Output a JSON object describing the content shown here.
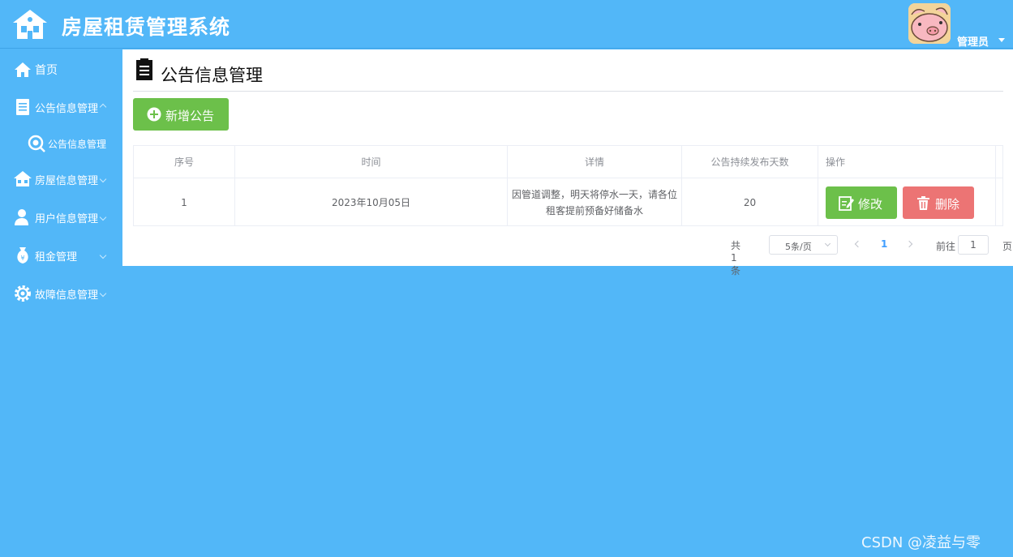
{
  "header": {
    "app_title": "房屋租赁管理系统",
    "user_name": "管理员"
  },
  "sidebar": {
    "items": [
      {
        "label": "首页",
        "icon": "home-icon"
      },
      {
        "label": "公告信息管理",
        "icon": "document-icon"
      },
      {
        "label": "公告信息管理",
        "icon": "search-icon",
        "sub": true
      },
      {
        "label": "房屋信息管理",
        "icon": "house-icon"
      },
      {
        "label": "用户信息管理",
        "icon": "user-icon"
      },
      {
        "label": "租金管理",
        "icon": "money-bag-icon"
      },
      {
        "label": "故障信息管理",
        "icon": "gear-icon"
      }
    ]
  },
  "main": {
    "page_title": "公告信息管理",
    "add_button": "新增公告",
    "table": {
      "columns": [
        "序号",
        "时间",
        "详情",
        "公告持续发布天数",
        "操作"
      ],
      "rows": [
        {
          "index": "1",
          "time": "2023年10月05日",
          "detail": "因管道调整，明天将停水一天，请各位租客提前预备好储备水",
          "days": "20"
        }
      ],
      "edit_label": "修改",
      "delete_label": "删除"
    },
    "pagination": {
      "total": "共 1 条",
      "page_size": "5条/页",
      "current_page": "1",
      "goto_label": "前往",
      "goto_value": "1",
      "page_suffix": "页"
    }
  },
  "watermark": "CSDN @凌益与零",
  "colors": {
    "background": "#52b7f8",
    "success": "#6cc04a",
    "danger": "#ec7474",
    "primary": "#409eff"
  }
}
